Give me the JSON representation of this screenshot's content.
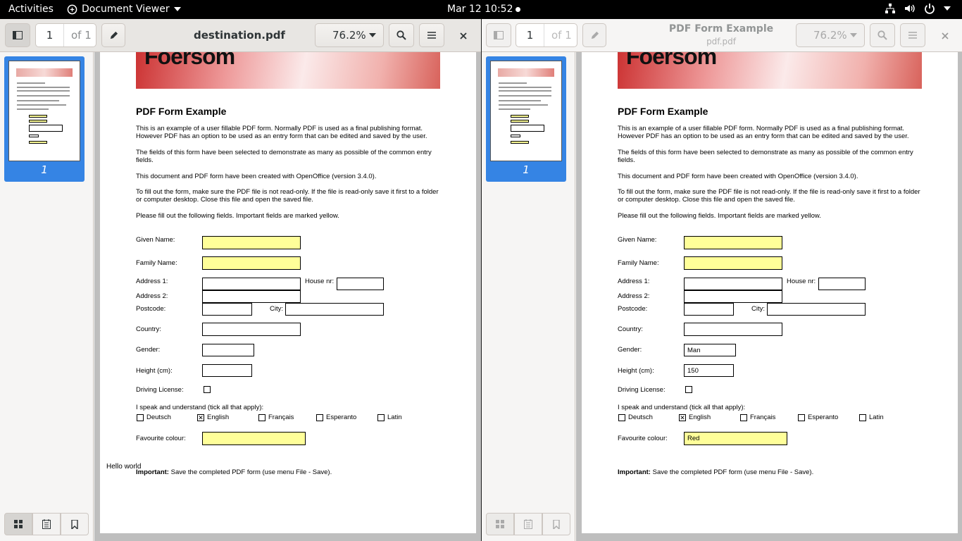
{
  "topbar": {
    "activities": "Activities",
    "app_name": "Document Viewer",
    "clock": "Mar 12  10:52"
  },
  "left": {
    "page_num": "1",
    "page_of": "of 1",
    "title": "destination.pdf",
    "zoom": "76.2%",
    "thumb_label": "1",
    "hello": "Hello world",
    "fields": {
      "given": "",
      "family": "",
      "addr1": "",
      "house": "",
      "addr2": "",
      "postcode": "",
      "city": "",
      "country": "",
      "gender": "",
      "height": "",
      "colour": ""
    },
    "checks": {
      "driving": "",
      "deutsch": "",
      "english": "✕",
      "francais": "",
      "esperanto": "",
      "latin": ""
    }
  },
  "right": {
    "page_num": "1",
    "page_of": "of 1",
    "title": "PDF Form Example",
    "subtitle": "pdf.pdf",
    "zoom": "76.2%",
    "thumb_label": "1",
    "fields": {
      "given": "",
      "family": "",
      "addr1": "",
      "house": "",
      "addr2": "",
      "postcode": "",
      "city": "",
      "country": "",
      "gender": "Man",
      "height": "150",
      "colour": "Red"
    },
    "checks": {
      "driving": "",
      "deutsch": "",
      "english": "✕",
      "francais": "",
      "esperanto": "",
      "latin": ""
    }
  },
  "doc": {
    "logo": "Foersom",
    "heading": "PDF Form Example",
    "p1": "This is an example of a user fillable PDF form. Normally PDF is used as a final publishing format. However PDF has an option to be used as an entry form that can be edited and saved by the user.",
    "p2": "The fields of this form have been selected to demonstrate as many as possible of the common entry fields.",
    "p3": "This document and PDF form have been created with OpenOffice (version 3.4.0).",
    "p4": "To fill out the form, make sure the PDF file is not read-only. If the file is read-only save it first to a folder or computer desktop. Close this file and open the saved file.",
    "p5": "Please fill out the following fields. Important fields are marked yellow.",
    "l_given": "Given Name:",
    "l_family": "Family Name:",
    "l_addr1": "Address 1:",
    "l_house": "House nr:",
    "l_addr2": "Address 2:",
    "l_postcode": "Postcode:",
    "l_city": "City:",
    "l_country": "Country:",
    "l_gender": "Gender:",
    "l_height": "Height (cm):",
    "l_driving": "Driving License:",
    "l_speak": "I speak and understand (tick all that apply):",
    "l_deutsch": "Deutsch",
    "l_english": "English",
    "l_francais": "Français",
    "l_esperanto": "Esperanto",
    "l_latin": "Latin",
    "l_colour": "Favourite colour:",
    "important_bold": "Important:",
    "important_rest": " Save the completed PDF form (use menu File - Save)."
  }
}
